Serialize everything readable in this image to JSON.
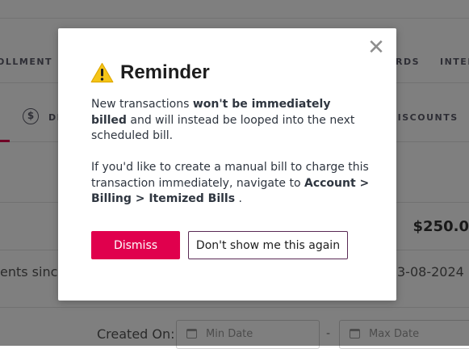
{
  "background": {
    "nav": {
      "left_item": "OLLMENT",
      "right_items": [
        "RDS",
        "INTER"
      ]
    },
    "subnav": {
      "left_item": "DI",
      "right_item": "DISCOUNTS"
    },
    "balance_amount": "$250.0",
    "since_text": "ents since",
    "date_text": "3-08-2024",
    "created_on_label": "Created On:",
    "min_date_placeholder": "Min Date",
    "max_date_placeholder": "Max Date",
    "range_separator": "-"
  },
  "modal": {
    "title": "Reminder",
    "close_symbol": "✕",
    "paragraph1": {
      "pre": "New transactions ",
      "bold": "won't be immediately billed",
      "post": " and will instead be looped into the next scheduled bill."
    },
    "paragraph2": {
      "pre": "If you'd like to create a manual bill to charge this transaction immediately, navigate to ",
      "bold": "Account > Billing > Itemized Bills",
      "post": " ."
    },
    "dismiss_label": "Dismiss",
    "dont_show_label": "Don't show me this again"
  },
  "colors": {
    "accent": "#e0004d",
    "warning": "#f5c518",
    "outline_button_border": "#5a2a55"
  }
}
